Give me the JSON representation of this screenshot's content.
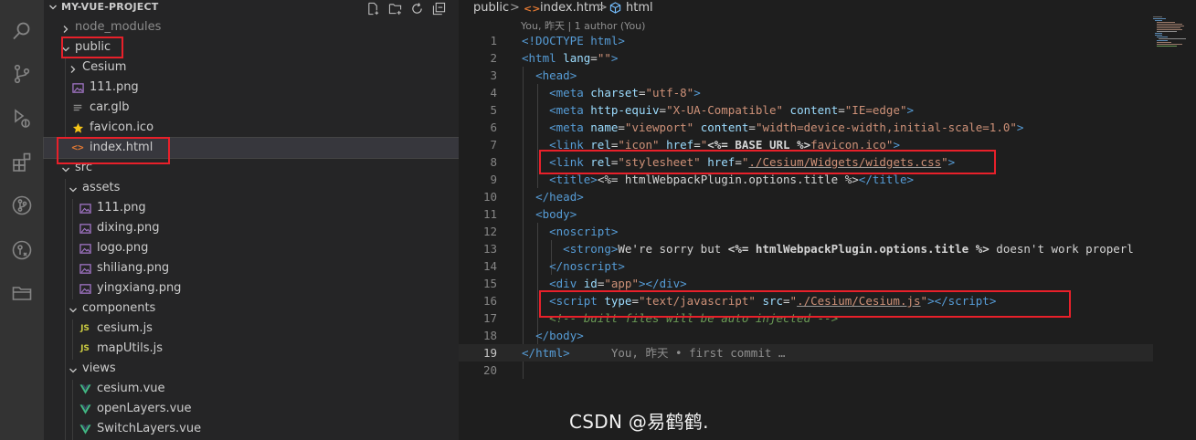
{
  "sidebar": {
    "project_title": "MY-VUE-PROJECT",
    "tree": [
      {
        "label": "node_modules",
        "icon": "chevron-right-icon"
      },
      {
        "label": "public",
        "icon": "chevron-down-icon"
      },
      {
        "label": "Cesium",
        "icon": "chevron-right-icon"
      },
      {
        "label": "111.png",
        "icon": "image-file-icon"
      },
      {
        "label": "car.glb",
        "icon": "file-icon"
      },
      {
        "label": "favicon.ico",
        "icon": "star-file-icon"
      },
      {
        "label": "index.html",
        "icon": "html-file-icon"
      },
      {
        "label": "src",
        "icon": "chevron-down-icon"
      },
      {
        "label": "assets",
        "icon": "chevron-down-icon"
      },
      {
        "label": "111.png",
        "icon": "image-file-icon"
      },
      {
        "label": "dixing.png",
        "icon": "image-file-icon"
      },
      {
        "label": "logo.png",
        "icon": "image-file-icon"
      },
      {
        "label": "shiliang.png",
        "icon": "image-file-icon"
      },
      {
        "label": "yingxiang.png",
        "icon": "image-file-icon"
      },
      {
        "label": "components",
        "icon": "chevron-down-icon"
      },
      {
        "label": "cesium.js",
        "icon": "js-file-icon"
      },
      {
        "label": "mapUtils.js",
        "icon": "js-file-icon"
      },
      {
        "label": "views",
        "icon": "chevron-down-icon"
      },
      {
        "label": "cesium.vue",
        "icon": "vue-file-icon"
      },
      {
        "label": "openLayers.vue",
        "icon": "vue-file-icon"
      },
      {
        "label": "SwitchLayers.vue",
        "icon": "vue-file-icon"
      }
    ],
    "js_badge": "JS"
  },
  "editor": {
    "breadcrumb": {
      "folder": "public",
      "sep": ">",
      "file": "index.html",
      "symbol": "html"
    },
    "codelens": "You, 昨天 | 1 author (You)",
    "line_numbers": [
      "1",
      "2",
      "3",
      "4",
      "5",
      "6",
      "7",
      "8",
      "9",
      "10",
      "11",
      "12",
      "13",
      "14",
      "15",
      "16",
      "17",
      "18",
      "19",
      "20"
    ],
    "current_line": "19",
    "blame": "You, 昨天 • first commit …",
    "code": {
      "l1": "<!DOCTYPE html>",
      "l2_open": "<",
      "l2_tag": "html",
      "l2_attr": "lang",
      "l2_eq": "=",
      "l2_val": "\"\"",
      "l2_close": ">",
      "l3_tag": "head",
      "l4_tag": "meta",
      "l4_attr": "charset",
      "l4_val": "\"utf-8\"",
      "l5_tag": "meta",
      "l5_attr1": "http-equiv",
      "l5_val1": "\"X-UA-Compatible\"",
      "l5_attr2": "content",
      "l5_val2": "\"IE=edge\"",
      "l6_tag": "meta",
      "l6_attr1": "name",
      "l6_val1": "\"viewport\"",
      "l6_attr2": "content",
      "l6_val2": "\"width=device-width,initial-scale=1.0\"",
      "l7_tag": "link",
      "l7_attr1": "rel",
      "l7_val1": "\"icon\"",
      "l7_attr2": "href",
      "l7_q1": "\"",
      "l7_ejs": "<%= BASE_URL %>",
      "l7_val2": "favicon.ico\"",
      "l8_tag": "link",
      "l8_attr1": "rel",
      "l8_val1": "\"stylesheet\"",
      "l8_attr2": "href",
      "l8_q1": "\"",
      "l8_path": "./Cesium/Widgets/widgets.css",
      "l8_q2": "\"",
      "l9_tag": "title",
      "l9_text": "<%= htmlWebpackPlugin.options.title %>",
      "l9_close": "title",
      "l10_tag": "head",
      "l11_tag": "body",
      "l12_tag": "noscript",
      "l13_tag": "strong",
      "l13_text": "We're sorry but ",
      "l13_ejs": "<%= htmlWebpackPlugin.options.title %>",
      "l13_text2": " doesn't work properl",
      "l14_tag": "noscript",
      "l15_tag": "div",
      "l15_attr": "id",
      "l15_val": "\"app\"",
      "l15_close": "div",
      "l16_tag": "script",
      "l16_attr1": "type",
      "l16_val1": "\"text/javascript\"",
      "l16_attr2": "src",
      "l16_q1": "\"",
      "l16_path": "./Cesium/Cesium.js",
      "l16_q2": "\"",
      "l16_close": "script",
      "l17_comment": "<!-- built files will be auto injected -->",
      "l18_tag": "body",
      "l19_tag": "html"
    }
  },
  "watermark": "CSDN @易鹤鹤."
}
